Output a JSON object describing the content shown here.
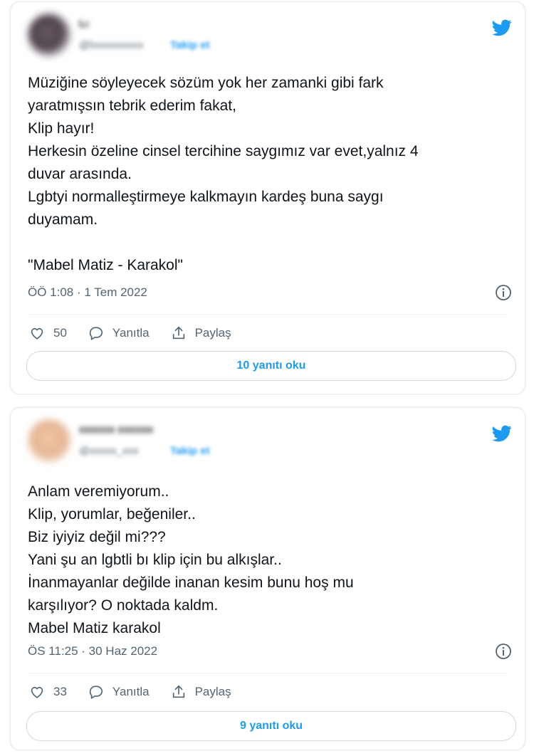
{
  "tweets": [
    {
      "display_name": "Lı",
      "handle": "@lıxxxxxxxxx",
      "follow_label": "Takip et",
      "avatar_icon": "user-avatar-blurred",
      "platform_icon": "twitter-bird-icon",
      "text": "Müziğine söyleyecek sözüm yok her zamanki gibi fark\nyaratmışsın tebrik ederim fakat,\nKlip hayır!\nHerkesin özeline cinsel tercihine saygımız var evet,yalnız 4\nduvar arasında.\nLgbtyi normalleştirmeye kalkmayın kardeş buna saygı\nduyamam.\n\n\"Mabel Matiz - Karakol\"",
      "timestamp": "ÖÖ 1:08 · 1 Tem 2022",
      "likes": "50",
      "reply_label": "Yanıtla",
      "share_label": "Paylaş",
      "read_replies_label": "10 yanıtı oku"
    },
    {
      "display_name": "xxxxxx xxxxxx",
      "handle": "@xxxxx_xxx",
      "follow_label": "Takip et",
      "avatar_icon": "user-avatar-blurred",
      "platform_icon": "twitter-bird-icon",
      "text": "Anlam veremiyorum..\nKlip, yorumlar, beğeniler..\nBiz iyiyiz değil mi???\nYani şu an lgbtli bı klip için bu alkışlar..\nİnanmayanlar değilde inanan kesim bunu hoş mu\nkarşılıyor? O noktada kaldm.\nMabel Matiz karakol",
      "timestamp": "ÖS 11:25 · 30 Haz 2022",
      "likes": "33",
      "reply_label": "Yanıtla",
      "share_label": "Paylaş",
      "read_replies_label": "9 yanıtı oku"
    }
  ],
  "colors": {
    "twitter_blue": "#1d9bf0",
    "text_primary": "#0f1419",
    "text_secondary": "#536471",
    "border": "#cfd9de"
  }
}
